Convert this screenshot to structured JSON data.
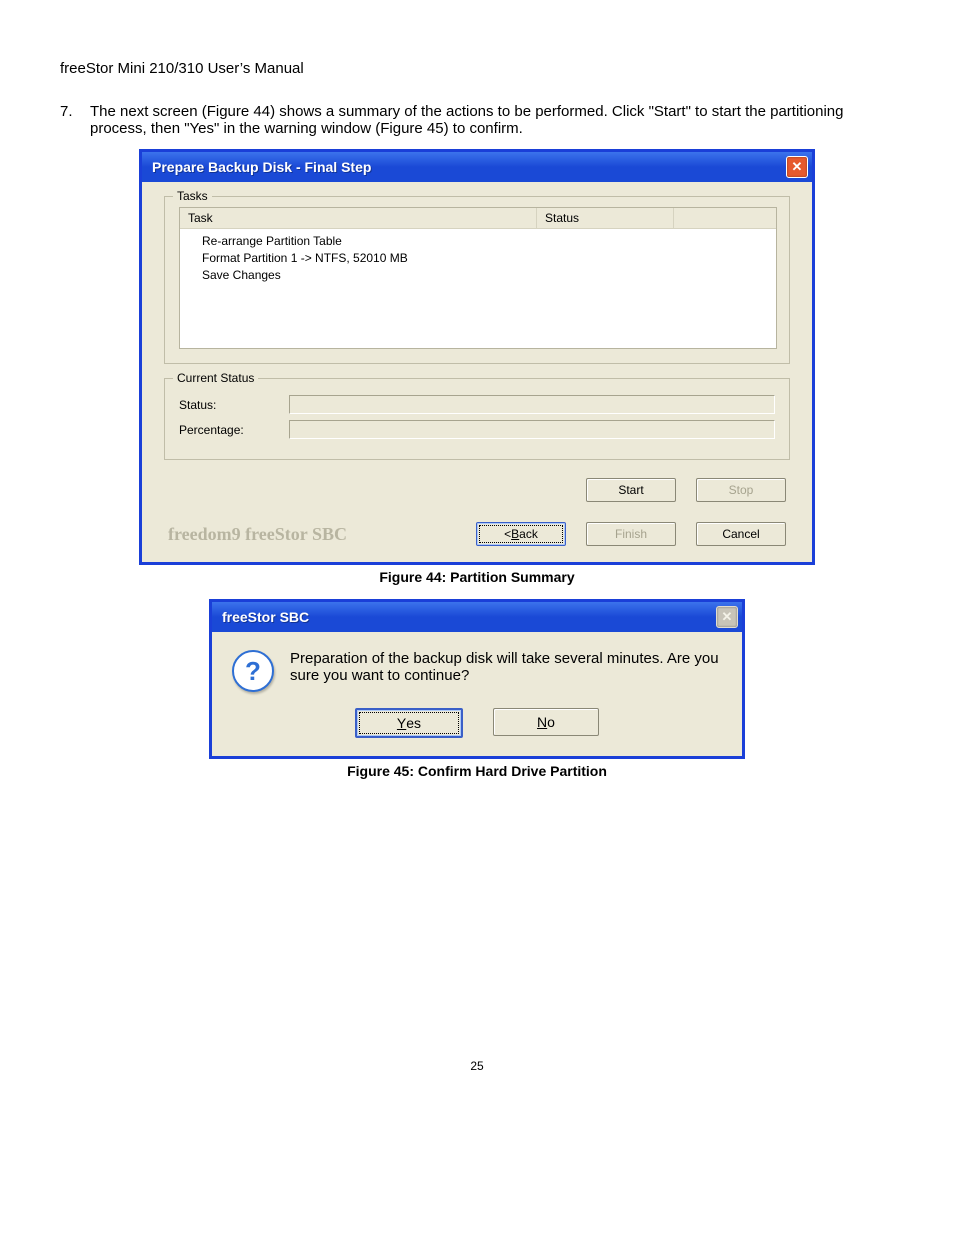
{
  "doc": {
    "header": "freeStor Mini 210/310 User’s Manual",
    "step_number": "7.",
    "step_text": "The next screen (Figure 44) shows a summary of the actions to be performed.  Click \"Start\" to start the partitioning process, then \"Yes\" in the warning window (Figure 45) to confirm.",
    "caption44": "Figure 44: Partition Summary",
    "caption45": "Figure 45: Confirm Hard Drive Partition",
    "page_number": "25"
  },
  "win1": {
    "title": "Prepare Backup Disk - Final Step",
    "group_tasks": "Tasks",
    "col_task": "Task",
    "col_status": "Status",
    "rows": [
      "Re-arrange Partition Table",
      "Format Partition 1 -> NTFS, 52010 MB",
      "Save Changes"
    ],
    "group_status": "Current Status",
    "label_status": "Status:",
    "label_percentage": "Percentage:",
    "btn_start": "Start",
    "btn_stop": "Stop",
    "brand": "freedom9 freeStor SBC",
    "btn_back_prefix": "< ",
    "btn_back_u": "B",
    "btn_back_suffix": "ack",
    "btn_finish": "Finish",
    "btn_cancel": "Cancel"
  },
  "win2": {
    "title": "freeStor SBC",
    "message": "Preparation of the backup disk will take several minutes. Are you sure you want to continue?",
    "btn_yes_u": "Y",
    "btn_yes_suffix": "es",
    "btn_no_u": "N",
    "btn_no_suffix": "o"
  }
}
